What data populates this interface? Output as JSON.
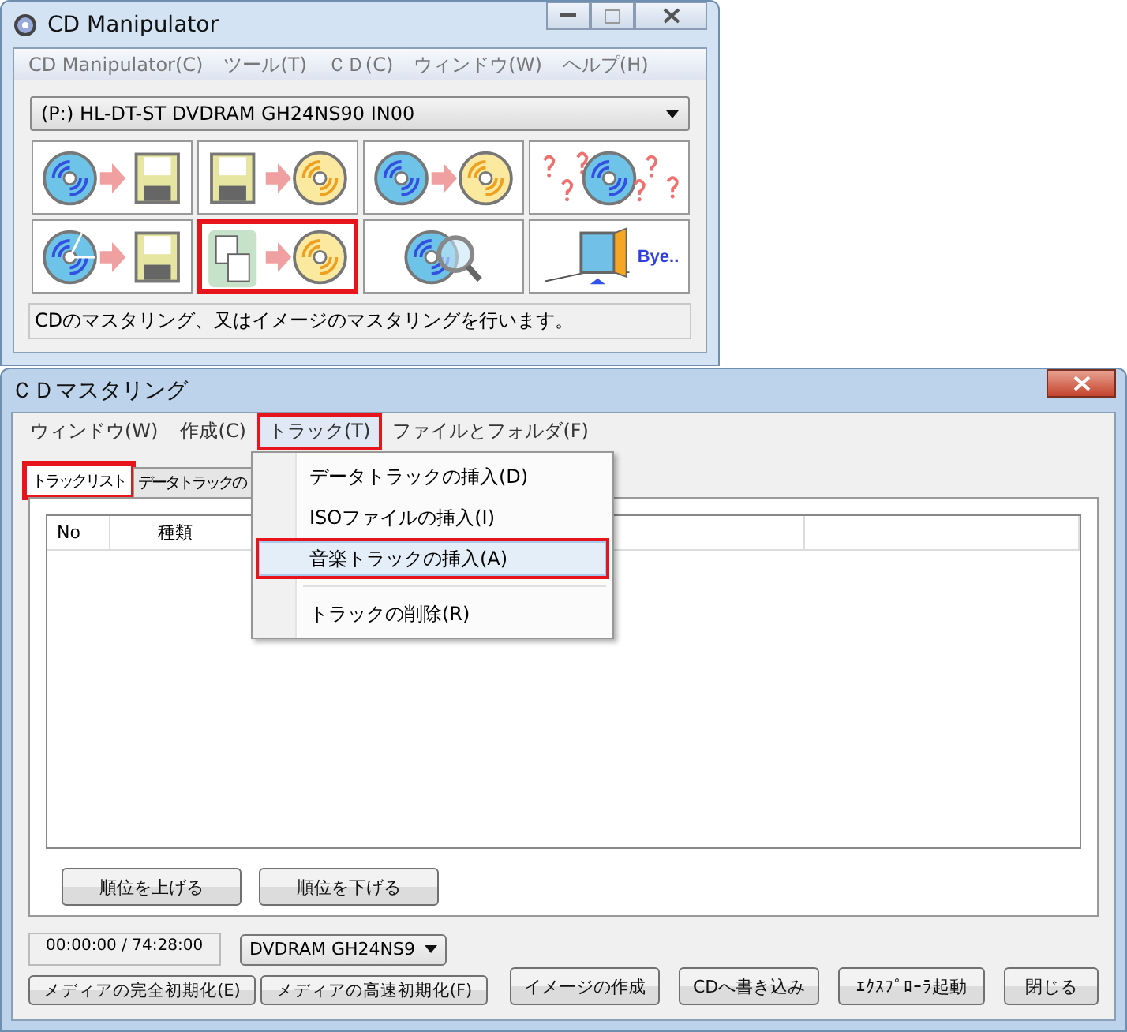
{
  "main_window": {
    "title": "CD Manipulator",
    "menu": [
      "CD Manipulator(C)",
      "ツール(T)",
      "ＣＤ(C)",
      "ウィンドウ(W)",
      "ヘルプ(H)"
    ],
    "drive": "(P:) HL-DT-ST DVDRAM GH24NS90 IN00",
    "tools": [
      {
        "highlighted": false
      },
      {
        "highlighted": false
      },
      {
        "highlighted": false
      },
      {
        "highlighted": false
      },
      {
        "highlighted": false
      },
      {
        "highlighted": true
      },
      {
        "highlighted": false
      },
      {
        "highlighted": false,
        "label": "Bye.."
      }
    ],
    "status": "CDのマスタリング、又はイメージのマスタリングを行います。"
  },
  "mastering_window": {
    "title": "ＣＤマスタリング",
    "menu": [
      {
        "label": "ウィンドウ(W)",
        "highlighted": false,
        "open": false
      },
      {
        "label": "作成(C)",
        "highlighted": false,
        "open": false
      },
      {
        "label": "トラック(T)",
        "highlighted": true,
        "open": true
      },
      {
        "label": "ファイルとフォルダ(F)",
        "highlighted": false,
        "open": false
      }
    ],
    "tabs": [
      {
        "label": "トラックリスト",
        "selected": true,
        "highlighted": true
      },
      {
        "label": "データトラックの",
        "selected": false,
        "highlighted": false
      }
    ],
    "columns": [
      "No",
      "種類"
    ],
    "dropdown": [
      {
        "kind": "item",
        "label": "データトラックの挿入(D)",
        "hovered": false,
        "highlighted": false
      },
      {
        "kind": "item",
        "label": "ISOファイルの挿入(I)",
        "hovered": false,
        "highlighted": false
      },
      {
        "kind": "item",
        "label": "音楽トラックの挿入(A)",
        "hovered": true,
        "highlighted": true
      },
      {
        "kind": "separator"
      },
      {
        "kind": "item",
        "label": "トラックの削除(R)",
        "hovered": false,
        "highlighted": false
      }
    ],
    "order_buttons": [
      "順位を上げる",
      "順位を下げる"
    ],
    "time": "00:00:00 / 74:28:00",
    "drive": "DVDRAM GH24NS9",
    "init_buttons": [
      "メディアの完全初期化(E)",
      "メディアの高速初期化(F)"
    ],
    "action_buttons": [
      "イメージの作成",
      "CDへ書き込み",
      "ｴｸｽﾌﾟﾛｰﾗ起動",
      "閉じる"
    ]
  }
}
